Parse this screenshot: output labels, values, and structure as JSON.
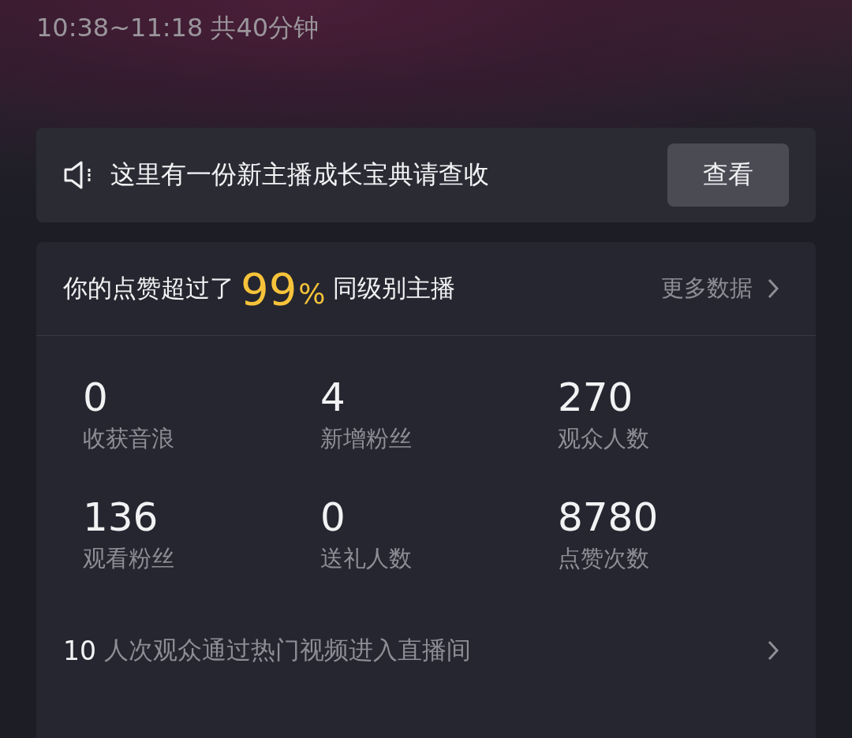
{
  "session_time": "10:38~11:18 共40分钟",
  "notice": {
    "text": "这里有一份新主播成长宝典请查收",
    "button": "查看"
  },
  "summary": {
    "prefix": "你的点赞超过了",
    "percent": "99",
    "percent_sign": "%",
    "suffix": "同级别主播",
    "more_link": "更多数据"
  },
  "stats": [
    {
      "value": "0",
      "label": "收获音浪"
    },
    {
      "value": "4",
      "label": "新增粉丝"
    },
    {
      "value": "270",
      "label": "观众人数"
    },
    {
      "value": "136",
      "label": "观看粉丝"
    },
    {
      "value": "0",
      "label": "送礼人数"
    },
    {
      "value": "8780",
      "label": "点赞次数"
    }
  ],
  "referral": {
    "count": "10",
    "text": "人次观众通过热门视频进入直播间"
  }
}
